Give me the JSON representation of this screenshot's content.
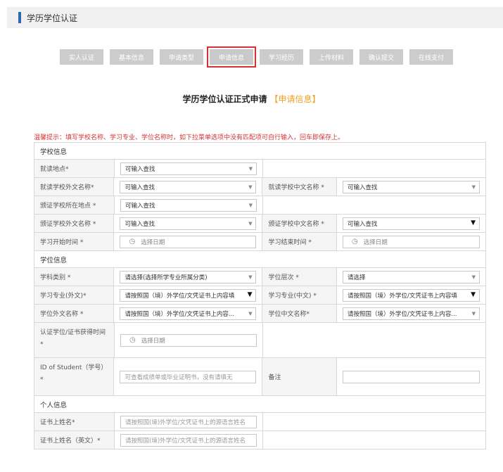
{
  "header": {
    "title": "学历学位认证"
  },
  "steps": [
    {
      "label": "实人认证"
    },
    {
      "label": "基本信息"
    },
    {
      "label": "申请类型"
    },
    {
      "label": "申请信息"
    },
    {
      "label": "学习经历"
    },
    {
      "label": "上传材料"
    },
    {
      "label": "确认提交"
    },
    {
      "label": "在线支付"
    }
  ],
  "form_title": {
    "main": "学历学位认证正式申请",
    "highlight": "【申请信息】"
  },
  "tip": "温馨提示：填写学校名称、学习专业、学位名称时，如下拉菜单选项中没有匹配项可自行输入，回车即保存上。",
  "sections": {
    "school": "学校信息",
    "degree": "学位信息",
    "personal": "个人信息"
  },
  "fields": {
    "study_location": {
      "label": "就读地点*",
      "value": "可输入查找"
    },
    "school_foreign": {
      "label": "就读学校外文名称*",
      "value": "可输入查找"
    },
    "school_chinese": {
      "label": "就读学校中文名称 *",
      "value": "可输入查找"
    },
    "issuer_location": {
      "label": "颁证学校所在地点 *",
      "value": "可输入查找"
    },
    "issuer_foreign": {
      "label": "颁证学校外文名称 *",
      "value": "可输入查找"
    },
    "issuer_chinese": {
      "label": "颁证学校中文名称 *",
      "value": "可输入查找"
    },
    "start_time": {
      "label": "学习开始时间 *",
      "value": "选择日期"
    },
    "end_time": {
      "label": "学习结束时间 *",
      "value": "选择日期"
    },
    "subject_category": {
      "label": "学科类别 *",
      "value": "请选择(选择所学专业所属分类)"
    },
    "degree_level": {
      "label": "学位层次 *",
      "value": "请选择"
    },
    "major_foreign": {
      "label": "学习专业(外文)*",
      "value": "请按照国（境）外学位/文凭证书上内容填"
    },
    "major_chinese": {
      "label": "学习专业(中文) *",
      "value": "请按照国（境）外学位/文凭证书上内容填"
    },
    "degree_foreign": {
      "label": "学位外文名称 *",
      "value": "请按照国（境）外学位/文凭证书上内容..."
    },
    "degree_chinese": {
      "label": "学位中文名称*",
      "value": "请按照国（境）外学位/文凭证书上内容..."
    },
    "obtained_time": {
      "label": "认证学位/证书获得时间 *",
      "value": "选择日期"
    },
    "student_id": {
      "label": "ID of Student（学号）*",
      "placeholder": "可查看成绩单或毕业证明书，没有请填无"
    },
    "remark": {
      "label": "备注",
      "value": ""
    },
    "cert_name": {
      "label": "证书上姓名*",
      "placeholder": "请按照国(境)外学位/文凭证书上的源语言姓名"
    },
    "cert_name_en": {
      "label": "证书上姓名（英文）*",
      "placeholder": "请按照国(境)外学位/文凭证书上的源语言姓名"
    }
  }
}
